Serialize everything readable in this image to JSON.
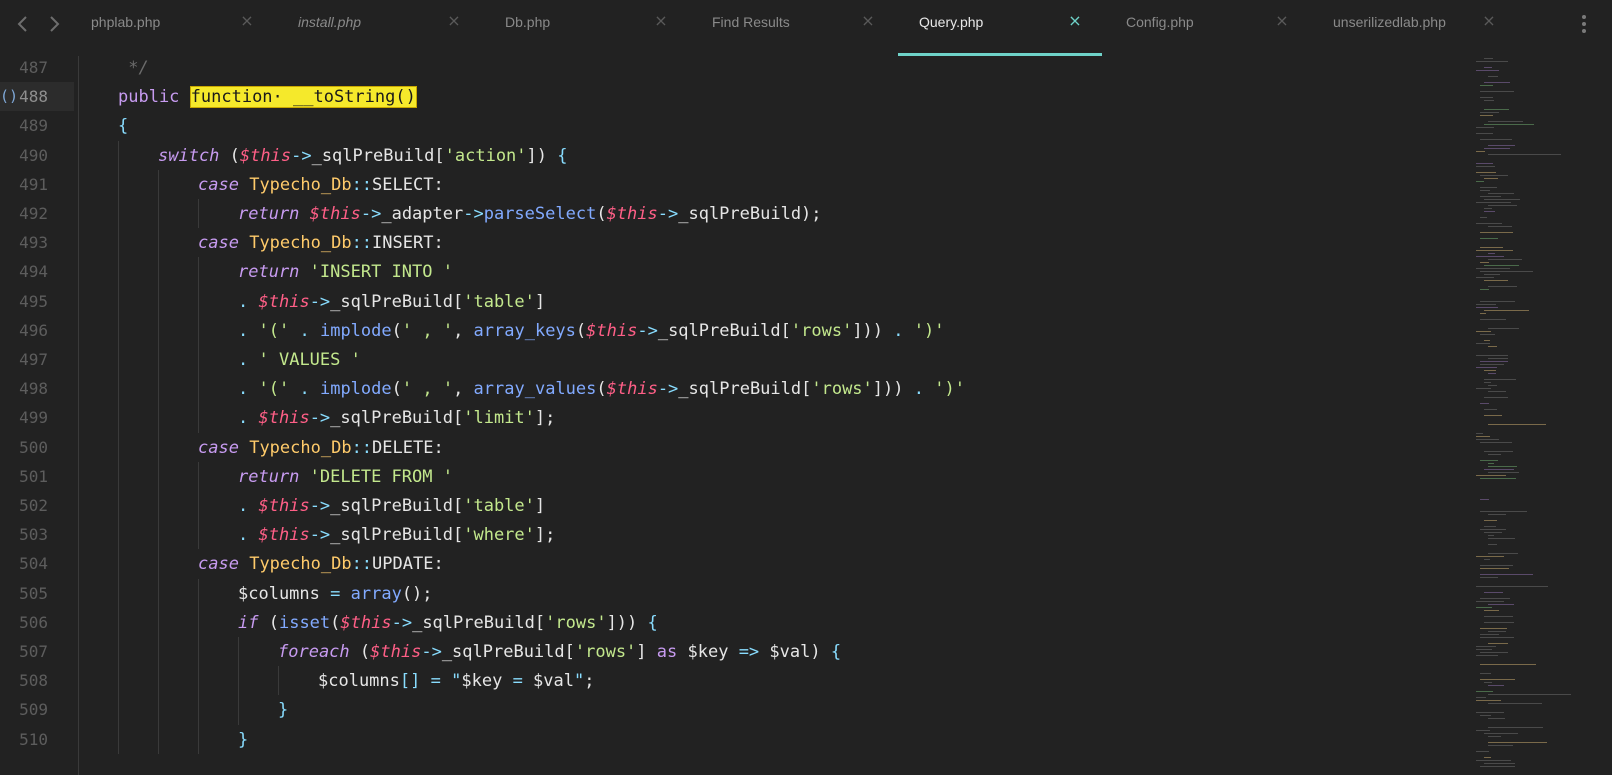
{
  "tabs": [
    {
      "label": "phplab.php",
      "italic": false,
      "active": false,
      "close": "×"
    },
    {
      "label": "install.php",
      "italic": true,
      "active": false,
      "close": "×"
    },
    {
      "label": "Db.php",
      "italic": false,
      "active": false,
      "close": "×"
    },
    {
      "label": "Find Results",
      "italic": false,
      "active": false,
      "close": "×"
    },
    {
      "label": "Query.php",
      "italic": false,
      "active": true,
      "close": "×"
    },
    {
      "label": "Config.php",
      "italic": false,
      "active": false,
      "close": "×"
    },
    {
      "label": "unserilizedlab.php",
      "italic": false,
      "active": false,
      "close": "×"
    }
  ],
  "icons": {
    "back": "chevron-left-icon",
    "forward": "chevron-right-icon",
    "more": "more-vertical-icon"
  },
  "editor": {
    "current_line": 488,
    "gutter_marker": "()",
    "lines": [
      {
        "n": 487,
        "indent": 0,
        "tokens": [
          [
            "comment",
            " */"
          ]
        ]
      },
      {
        "n": 488,
        "indent": 0,
        "tokens": [
          [
            "kw-purple",
            "public "
          ],
          [
            "hl",
            "function· __toString()"
          ]
        ]
      },
      {
        "n": 489,
        "indent": 0,
        "tokens": [
          [
            "op",
            "{"
          ]
        ]
      },
      {
        "n": 490,
        "indent": 1,
        "tokens": [
          [
            "kw-italic",
            "switch"
          ],
          [
            "plain",
            " ("
          ],
          [
            "this",
            "$this"
          ],
          [
            "op",
            "->"
          ],
          [
            "plain",
            "_sqlPreBuild["
          ],
          [
            "str",
            "'action'"
          ],
          [
            "plain",
            "]) "
          ],
          [
            "op",
            "{"
          ]
        ]
      },
      {
        "n": 491,
        "indent": 2,
        "tokens": [
          [
            "kw-italic",
            "case"
          ],
          [
            "plain",
            " "
          ],
          [
            "cls",
            "Typecho_Db"
          ],
          [
            "op",
            "::"
          ],
          [
            "plain",
            "SELECT:"
          ]
        ]
      },
      {
        "n": 492,
        "indent": 3,
        "tokens": [
          [
            "kw-italic",
            "return"
          ],
          [
            "plain",
            " "
          ],
          [
            "this",
            "$this"
          ],
          [
            "op",
            "->"
          ],
          [
            "plain",
            "_adapter"
          ],
          [
            "op",
            "->"
          ],
          [
            "fn",
            "parseSelect"
          ],
          [
            "plain",
            "("
          ],
          [
            "this",
            "$this"
          ],
          [
            "op",
            "->"
          ],
          [
            "plain",
            "_sqlPreBuild);"
          ]
        ]
      },
      {
        "n": 493,
        "indent": 2,
        "tokens": [
          [
            "kw-italic",
            "case"
          ],
          [
            "plain",
            " "
          ],
          [
            "cls",
            "Typecho_Db"
          ],
          [
            "op",
            "::"
          ],
          [
            "plain",
            "INSERT:"
          ]
        ]
      },
      {
        "n": 494,
        "indent": 3,
        "tokens": [
          [
            "kw-italic",
            "return"
          ],
          [
            "plain",
            " "
          ],
          [
            "str",
            "'INSERT INTO '"
          ]
        ]
      },
      {
        "n": 495,
        "indent": 3,
        "tokens": [
          [
            "op",
            "."
          ],
          [
            "plain",
            " "
          ],
          [
            "this",
            "$this"
          ],
          [
            "op",
            "->"
          ],
          [
            "plain",
            "_sqlPreBuild["
          ],
          [
            "str",
            "'table'"
          ],
          [
            "plain",
            "]"
          ]
        ]
      },
      {
        "n": 496,
        "indent": 3,
        "tokens": [
          [
            "op",
            "."
          ],
          [
            "plain",
            " "
          ],
          [
            "str",
            "'('"
          ],
          [
            "plain",
            " "
          ],
          [
            "op",
            "."
          ],
          [
            "plain",
            " "
          ],
          [
            "fn",
            "implode"
          ],
          [
            "plain",
            "("
          ],
          [
            "str",
            "' , '"
          ],
          [
            "plain",
            ", "
          ],
          [
            "fn",
            "array_keys"
          ],
          [
            "plain",
            "("
          ],
          [
            "this",
            "$this"
          ],
          [
            "op",
            "->"
          ],
          [
            "plain",
            "_sqlPreBuild["
          ],
          [
            "str",
            "'rows'"
          ],
          [
            "plain",
            "])) "
          ],
          [
            "op",
            "."
          ],
          [
            "plain",
            " "
          ],
          [
            "str",
            "')'"
          ]
        ]
      },
      {
        "n": 497,
        "indent": 3,
        "tokens": [
          [
            "op",
            "."
          ],
          [
            "plain",
            " "
          ],
          [
            "str",
            "' VALUES '"
          ]
        ]
      },
      {
        "n": 498,
        "indent": 3,
        "tokens": [
          [
            "op",
            "."
          ],
          [
            "plain",
            " "
          ],
          [
            "str",
            "'('"
          ],
          [
            "plain",
            " "
          ],
          [
            "op",
            "."
          ],
          [
            "plain",
            " "
          ],
          [
            "fn",
            "implode"
          ],
          [
            "plain",
            "("
          ],
          [
            "str",
            "' , '"
          ],
          [
            "plain",
            ", "
          ],
          [
            "fn",
            "array_values"
          ],
          [
            "plain",
            "("
          ],
          [
            "this",
            "$this"
          ],
          [
            "op",
            "->"
          ],
          [
            "plain",
            "_sqlPreBuild["
          ],
          [
            "str",
            "'rows'"
          ],
          [
            "plain",
            "])) "
          ],
          [
            "op",
            "."
          ],
          [
            "plain",
            " "
          ],
          [
            "str",
            "')'"
          ]
        ]
      },
      {
        "n": 499,
        "indent": 3,
        "tokens": [
          [
            "op",
            "."
          ],
          [
            "plain",
            " "
          ],
          [
            "this",
            "$this"
          ],
          [
            "op",
            "->"
          ],
          [
            "plain",
            "_sqlPreBuild["
          ],
          [
            "str",
            "'limit'"
          ],
          [
            "plain",
            "];"
          ]
        ]
      },
      {
        "n": 500,
        "indent": 2,
        "tokens": [
          [
            "kw-italic",
            "case"
          ],
          [
            "plain",
            " "
          ],
          [
            "cls",
            "Typecho_Db"
          ],
          [
            "op",
            "::"
          ],
          [
            "plain",
            "DELETE:"
          ]
        ]
      },
      {
        "n": 501,
        "indent": 3,
        "tokens": [
          [
            "kw-italic",
            "return"
          ],
          [
            "plain",
            " "
          ],
          [
            "str",
            "'DELETE FROM '"
          ]
        ]
      },
      {
        "n": 502,
        "indent": 3,
        "tokens": [
          [
            "op",
            "."
          ],
          [
            "plain",
            " "
          ],
          [
            "this",
            "$this"
          ],
          [
            "op",
            "->"
          ],
          [
            "plain",
            "_sqlPreBuild["
          ],
          [
            "str",
            "'table'"
          ],
          [
            "plain",
            "]"
          ]
        ]
      },
      {
        "n": 503,
        "indent": 3,
        "tokens": [
          [
            "op",
            "."
          ],
          [
            "plain",
            " "
          ],
          [
            "this",
            "$this"
          ],
          [
            "op",
            "->"
          ],
          [
            "plain",
            "_sqlPreBuild["
          ],
          [
            "str",
            "'where'"
          ],
          [
            "plain",
            "];"
          ]
        ]
      },
      {
        "n": 504,
        "indent": 2,
        "tokens": [
          [
            "kw-italic",
            "case"
          ],
          [
            "plain",
            " "
          ],
          [
            "cls",
            "Typecho_Db"
          ],
          [
            "op",
            "::"
          ],
          [
            "plain",
            "UPDATE:"
          ]
        ]
      },
      {
        "n": 505,
        "indent": 3,
        "tokens": [
          [
            "plain",
            "$columns "
          ],
          [
            "op",
            "="
          ],
          [
            "plain",
            " "
          ],
          [
            "fn",
            "array"
          ],
          [
            "plain",
            "();"
          ]
        ]
      },
      {
        "n": 506,
        "indent": 3,
        "tokens": [
          [
            "kw-italic",
            "if"
          ],
          [
            "plain",
            " ("
          ],
          [
            "fn",
            "isset"
          ],
          [
            "plain",
            "("
          ],
          [
            "this",
            "$this"
          ],
          [
            "op",
            "->"
          ],
          [
            "plain",
            "_sqlPreBuild["
          ],
          [
            "str",
            "'rows'"
          ],
          [
            "plain",
            "])) "
          ],
          [
            "op",
            "{"
          ]
        ]
      },
      {
        "n": 507,
        "indent": 4,
        "tokens": [
          [
            "kw-italic",
            "foreach"
          ],
          [
            "plain",
            " ("
          ],
          [
            "this",
            "$this"
          ],
          [
            "op",
            "->"
          ],
          [
            "plain",
            "_sqlPreBuild["
          ],
          [
            "str",
            "'rows'"
          ],
          [
            "plain",
            "] "
          ],
          [
            "kw-purple",
            "as"
          ],
          [
            "plain",
            " $key "
          ],
          [
            "op",
            "=>"
          ],
          [
            "plain",
            " $val) "
          ],
          [
            "op",
            "{"
          ]
        ]
      },
      {
        "n": 508,
        "indent": 5,
        "tokens": [
          [
            "plain",
            "$columns"
          ],
          [
            "op",
            "[]"
          ],
          [
            "plain",
            " "
          ],
          [
            "op",
            "="
          ],
          [
            "plain",
            " "
          ],
          [
            "op",
            "\""
          ],
          [
            "plain",
            "$key "
          ],
          [
            "op",
            "="
          ],
          [
            "plain",
            " $val"
          ],
          [
            "op",
            "\""
          ],
          [
            "plain",
            ";"
          ]
        ]
      },
      {
        "n": 509,
        "indent": 4,
        "tokens": [
          [
            "op",
            "}"
          ]
        ]
      },
      {
        "n": 510,
        "indent": 3,
        "tokens": [
          [
            "op",
            "}"
          ]
        ]
      }
    ]
  }
}
